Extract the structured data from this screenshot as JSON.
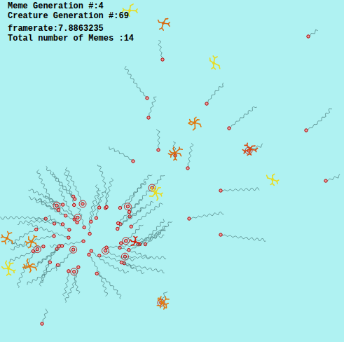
{
  "hud": {
    "lines": [
      "Meme Generation #:4",
      "Creature Generation #:69",
      "framerate:7.8863235",
      "Total number of Memes :14"
    ]
  },
  "memes": [
    {
      "color": "#e8dc20"
    },
    {
      "color": "#d86a10"
    },
    {
      "color": "#e8dc20"
    },
    {
      "color": "#e07a10"
    },
    {
      "color": "#d86a10"
    },
    {
      "color": "#d84a10"
    },
    {
      "color": "#e8dc20"
    },
    {
      "color": "#e8dc20"
    },
    {
      "color": "#e07a10"
    },
    {
      "color": "#e07a10"
    },
    {
      "color": "#e8dc20"
    },
    {
      "color": "#e07a10"
    },
    {
      "color": "#d02010"
    },
    {
      "color": "#e07a10"
    }
  ],
  "creatures": [
    {
      "ringed": false
    },
    {
      "ringed": false
    },
    {
      "ringed": false
    },
    {
      "ringed": false
    },
    {
      "ringed": false
    },
    {
      "ringed": false
    },
    {
      "ringed": false
    },
    {
      "ringed": false
    },
    {
      "ringed": false
    },
    {
      "ringed": false
    },
    {
      "ringed": false
    },
    {
      "ringed": false
    },
    {
      "ringed": false
    },
    {
      "ringed": false
    },
    {
      "ringed": true
    },
    {
      "ringed": true
    },
    {
      "ringed": true
    },
    {
      "ringed": false
    },
    {
      "ringed": false
    },
    {
      "ringed": false
    },
    {
      "ringed": true
    },
    {
      "ringed": false
    },
    {
      "ringed": false
    },
    {
      "ringed": false
    },
    {
      "ringed": false
    },
    {
      "ringed": false
    },
    {
      "ringed": true
    },
    {
      "ringed": false
    },
    {
      "ringed": false
    },
    {
      "ringed": false
    },
    {
      "ringed": false
    },
    {
      "ringed": false
    },
    {
      "ringed": true
    },
    {
      "ringed": false
    },
    {
      "ringed": false
    },
    {
      "ringed": false
    },
    {
      "ringed": false
    },
    {
      "ringed": false
    },
    {
      "ringed": true
    },
    {
      "ringed": false
    },
    {
      "ringed": false
    },
    {
      "ringed": false
    },
    {
      "ringed": false
    },
    {
      "ringed": false
    },
    {
      "ringed": true
    },
    {
      "ringed": false
    },
    {
      "ringed": false
    },
    {
      "ringed": false
    },
    {
      "ringed": false
    },
    {
      "ringed": false
    },
    {
      "ringed": true
    },
    {
      "ringed": false
    },
    {
      "ringed": false
    },
    {
      "ringed": false
    },
    {
      "ringed": false
    },
    {
      "ringed": false
    },
    {
      "ringed": true
    },
    {
      "ringed": false
    },
    {
      "ringed": false
    },
    {
      "ringed": false
    },
    {
      "ringed": false
    },
    {
      "ringed": false
    },
    {
      "ringed": true
    },
    {
      "ringed": false
    },
    {
      "ringed": false
    },
    {
      "ringed": false
    },
    {
      "ringed": false
    },
    {
      "ringed": false
    },
    {
      "ringed": true
    },
    {
      "ringed": false
    },
    {
      "ringed": false
    },
    {
      "ringed": false
    },
    {
      "ringed": false
    },
    {
      "ringed": false
    },
    {
      "ringed": true
    },
    {
      "ringed": false
    },
    {
      "ringed": false
    },
    {
      "ringed": false
    },
    {
      "ringed": false
    },
    {
      "ringed": false
    },
    {
      "ringed": false
    }
  ]
}
